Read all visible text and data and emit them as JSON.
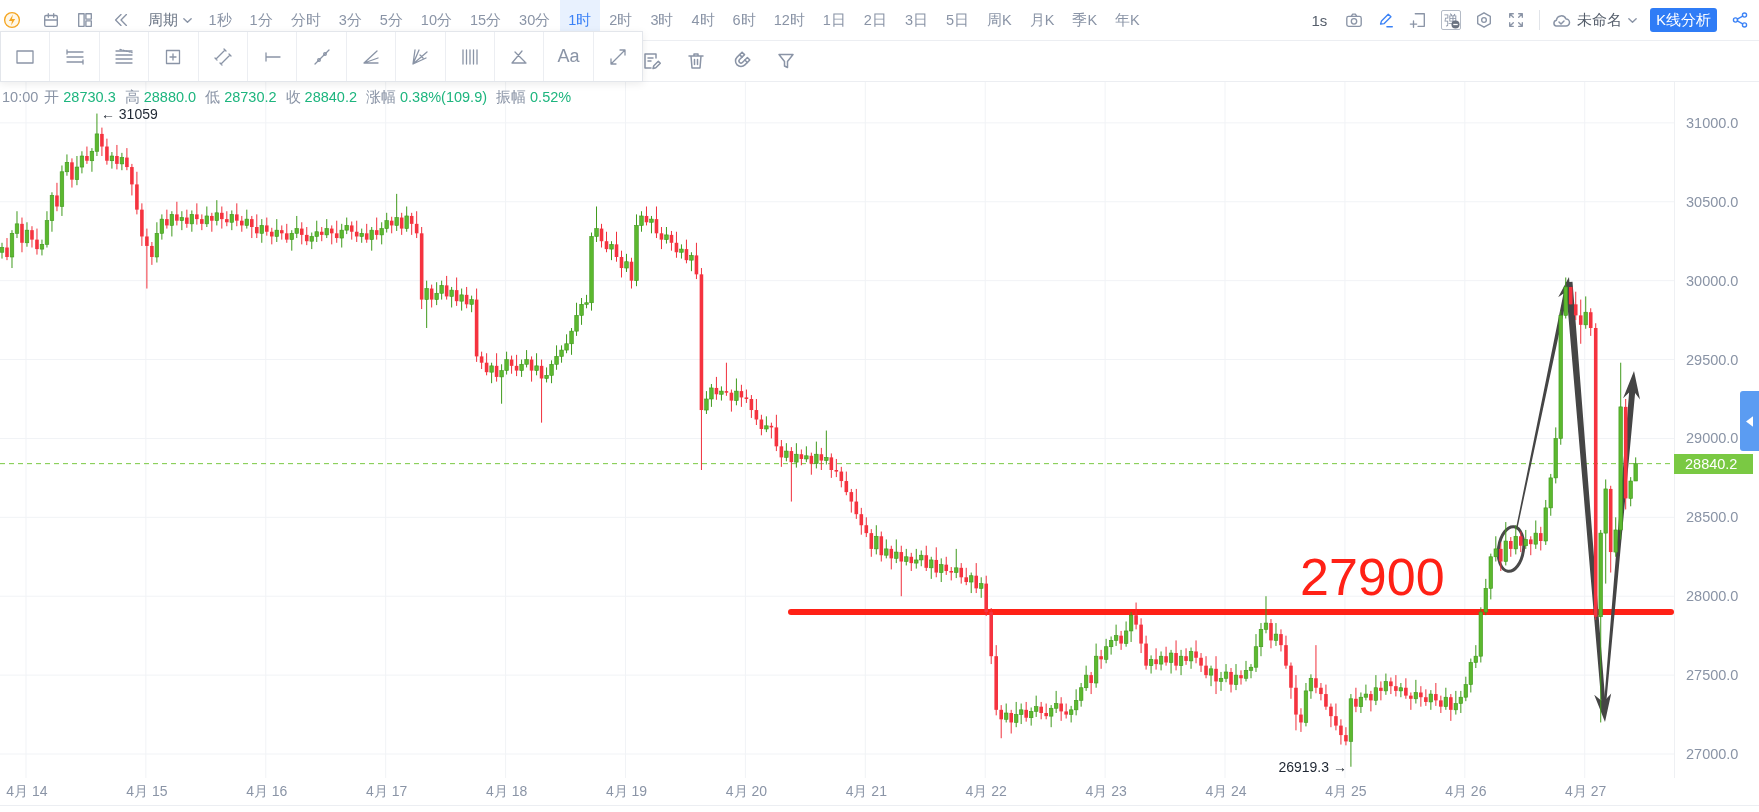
{
  "toolbar": {
    "period_label": "周期",
    "intervals": [
      {
        "label": "1秒",
        "selected": false
      },
      {
        "label": "1分",
        "selected": false
      },
      {
        "label": "分时",
        "selected": false
      },
      {
        "label": "3分",
        "selected": false
      },
      {
        "label": "5分",
        "selected": false
      },
      {
        "label": "10分",
        "selected": false
      },
      {
        "label": "15分",
        "selected": false
      },
      {
        "label": "30分",
        "selected": false
      },
      {
        "label": "1时",
        "selected": true
      },
      {
        "label": "2时",
        "selected": false
      },
      {
        "label": "3时",
        "selected": false
      },
      {
        "label": "4时",
        "selected": false
      },
      {
        "label": "6时",
        "selected": false
      },
      {
        "label": "12时",
        "selected": false
      },
      {
        "label": "1日",
        "selected": false
      },
      {
        "label": "2日",
        "selected": false
      },
      {
        "label": "3日",
        "selected": false
      },
      {
        "label": "5日",
        "selected": false
      },
      {
        "label": "周K",
        "selected": false
      },
      {
        "label": "月K",
        "selected": false
      },
      {
        "label": "季K",
        "selected": false
      },
      {
        "label": "年K",
        "selected": false
      }
    ],
    "refresh_rate": "1s",
    "drawing_mode": true,
    "barrage_icon_text": "弹",
    "layout_name": "未命名",
    "analysis_button": "K线分析"
  },
  "drawing_panel": {
    "text_tool": "Aa"
  },
  "ohlc": {
    "time": "10:00",
    "fields": [
      {
        "label": "开",
        "value": "28730.3"
      },
      {
        "label": "高",
        "value": "28880.0"
      },
      {
        "label": "低",
        "value": "28730.2"
      },
      {
        "label": "收",
        "value": "28840.2"
      },
      {
        "label": "涨幅",
        "value": "0.38%(109.9)"
      },
      {
        "label": "振幅",
        "value": "0.52%"
      }
    ]
  },
  "chart": {
    "chart_data": {
      "type": "candlestick",
      "categories": [
        null,
        null,
        null,
        null,
        null,
        "4月 14",
        null,
        null,
        null,
        null,
        null,
        null,
        null,
        null,
        null,
        null,
        null,
        null,
        null,
        null,
        null,
        null,
        null,
        null,
        null,
        null,
        null,
        null,
        null,
        "4月 15",
        null,
        null,
        null,
        null,
        null,
        null,
        null,
        null,
        null,
        null,
        null,
        null,
        null,
        null,
        null,
        null,
        null,
        null,
        null,
        null,
        null,
        null,
        null,
        "4月 16",
        null,
        null,
        null,
        null,
        null,
        null,
        null,
        null,
        null,
        null,
        null,
        null,
        null,
        null,
        null,
        null,
        null,
        null,
        null,
        null,
        null,
        null,
        null,
        "4月 17",
        null,
        null,
        null,
        null,
        null,
        null,
        null,
        null,
        null,
        null,
        null,
        null,
        null,
        null,
        null,
        null,
        null,
        null,
        null,
        null,
        null,
        null,
        null,
        "4月 18",
        null,
        null,
        null,
        null,
        null,
        null,
        null,
        null,
        null,
        null,
        null,
        null,
        null,
        null,
        null,
        null,
        null,
        null,
        null,
        null,
        null,
        null,
        null,
        "4月 19",
        null,
        null,
        null,
        null,
        null,
        null,
        null,
        null,
        null,
        null,
        null,
        null,
        null,
        null,
        null,
        null,
        null,
        null,
        null,
        null,
        null,
        null,
        null,
        "4月 20",
        null,
        null,
        null,
        null,
        null,
        null,
        null,
        null,
        null,
        null,
        null,
        null,
        null,
        null,
        null,
        null,
        null,
        null,
        null,
        null,
        null,
        null,
        null,
        "4月 21",
        null,
        null,
        null,
        null,
        null,
        null,
        null,
        null,
        null,
        null,
        null,
        null,
        null,
        null,
        null,
        null,
        null,
        null,
        null,
        null,
        null,
        null,
        null,
        "4月 22",
        null,
        null,
        null,
        null,
        null,
        null,
        null,
        null,
        null,
        null,
        null,
        null,
        null,
        null,
        null,
        null,
        null,
        null,
        null,
        null,
        null,
        null,
        null,
        "4月 23",
        null,
        null,
        null,
        null,
        null,
        null,
        null,
        null,
        null,
        null,
        null,
        null,
        null,
        null,
        null,
        null,
        null,
        null,
        null,
        null,
        null,
        null,
        null,
        "4月 24",
        null,
        null,
        null,
        null,
        null,
        null,
        null,
        null,
        null,
        null,
        null,
        null,
        null,
        null,
        null,
        null,
        null,
        null,
        null,
        null,
        null,
        null,
        null,
        "4月 25",
        null,
        null,
        null,
        null,
        null,
        null,
        null,
        null,
        null,
        null,
        null,
        null,
        null,
        null,
        null,
        null,
        null,
        null,
        null,
        null,
        null,
        null,
        null,
        "4月 26",
        null,
        null,
        null,
        null,
        null,
        null,
        null,
        null,
        null,
        null,
        null,
        null,
        null,
        null,
        null,
        null,
        null,
        null,
        null,
        null,
        null,
        null,
        null,
        "4月 27",
        null,
        null,
        null,
        null,
        null,
        null,
        null,
        null,
        null,
        null
      ],
      "ohlc": [
        [
          30180,
          30240,
          30140,
          30210
        ],
        [
          30210,
          30270,
          30130,
          30150
        ],
        [
          30150,
          30320,
          30080,
          30300
        ],
        [
          30300,
          30440,
          30270,
          30360
        ],
        [
          30360,
          30400,
          30180,
          30240
        ],
        [
          30240,
          30370,
          30215,
          30320
        ],
        [
          30320,
          30345,
          30210,
          30260
        ],
        [
          30260,
          30330,
          30165,
          30200
        ],
        [
          30200,
          30260,
          30160,
          30230
        ],
        [
          30230,
          30440,
          30210,
          30380
        ],
        [
          30380,
          30560,
          30310,
          30540
        ],
        [
          30540,
          30620,
          30440,
          30470
        ],
        [
          30470,
          30730,
          30410,
          30690
        ],
        [
          30690,
          30800,
          30665,
          30750
        ],
        [
          30750,
          30775,
          30590,
          30640
        ],
        [
          30640,
          30790,
          30605,
          30720
        ],
        [
          30720,
          30820,
          30680,
          30790
        ],
        [
          30790,
          30850,
          30740,
          30760
        ],
        [
          30760,
          30840,
          30690,
          30820
        ],
        [
          30820,
          31059,
          30790,
          30930
        ],
        [
          30930,
          30970,
          30790,
          30850
        ],
        [
          30850,
          30900,
          30735,
          30760
        ],
        [
          30760,
          30815,
          30710,
          30790
        ],
        [
          30790,
          30860,
          30705,
          30740
        ],
        [
          30740,
          30810,
          30700,
          30780
        ],
        [
          30780,
          30840,
          30700,
          30720
        ],
        [
          30720,
          30740,
          30540,
          30610
        ],
        [
          30610,
          30690,
          30420,
          30450
        ],
        [
          30450,
          30490,
          30220,
          30280
        ],
        [
          30280,
          30330,
          29950,
          30220
        ],
        [
          30220,
          30245,
          30100,
          30150
        ],
        [
          30150,
          30370,
          30115,
          30300
        ],
        [
          30300,
          30420,
          30260,
          30390
        ],
        [
          30390,
          30450,
          30330,
          30350
        ],
        [
          30350,
          30440,
          30280,
          30420
        ],
        [
          30420,
          30500,
          30350,
          30380
        ],
        [
          30380,
          30440,
          30320,
          30400
        ],
        [
          30400,
          30450,
          30335,
          30360
        ],
        [
          30360,
          30445,
          30310,
          30420
        ],
        [
          30420,
          30490,
          30355,
          30390
        ],
        [
          30390,
          30420,
          30320,
          30360
        ],
        [
          30360,
          30470,
          30340,
          30410
        ],
        [
          30410,
          30430,
          30310,
          30380
        ],
        [
          30380,
          30510,
          30350,
          30430
        ],
        [
          30430,
          30470,
          30330,
          30390
        ],
        [
          30390,
          30440,
          30345,
          30370
        ],
        [
          30370,
          30445,
          30320,
          30420
        ],
        [
          30420,
          30490,
          30345,
          30380
        ],
        [
          30380,
          30410,
          30310,
          30350
        ],
        [
          30350,
          30450,
          30330,
          30390
        ],
        [
          30390,
          30410,
          30270,
          30340
        ],
        [
          30340,
          30420,
          30270,
          30300
        ],
        [
          30300,
          30390,
          30240,
          30350
        ],
        [
          30350,
          30400,
          30285,
          30310
        ],
        [
          30310,
          30335,
          30230,
          30280
        ],
        [
          30280,
          30390,
          30245,
          30320
        ],
        [
          30320,
          30350,
          30260,
          30300
        ],
        [
          30300,
          30360,
          30240,
          30260
        ],
        [
          30260,
          30320,
          30190,
          30300
        ],
        [
          30300,
          30410,
          30270,
          30330
        ],
        [
          30330,
          30370,
          30230,
          30290
        ],
        [
          30290,
          30340,
          30225,
          30250
        ],
        [
          30250,
          30305,
          30200,
          30280
        ],
        [
          30280,
          30380,
          30245,
          30310
        ],
        [
          30310,
          30340,
          30250,
          30290
        ],
        [
          30290,
          30390,
          30270,
          30330
        ],
        [
          30330,
          30350,
          30230,
          30300
        ],
        [
          30300,
          30380,
          30240,
          30270
        ],
        [
          30270,
          30360,
          30210,
          30320
        ],
        [
          30320,
          30400,
          30295,
          30350
        ],
        [
          30350,
          30375,
          30260,
          30310
        ],
        [
          30310,
          30380,
          30245,
          30280
        ],
        [
          30280,
          30330,
          30240,
          30300
        ],
        [
          30300,
          30360,
          30240,
          30260
        ],
        [
          30260,
          30340,
          30190,
          30320
        ],
        [
          30320,
          30400,
          30260,
          30290
        ],
        [
          30290,
          30370,
          30230,
          30330
        ],
        [
          30330,
          30430,
          30305,
          30380
        ],
        [
          30380,
          30405,
          30300,
          30350
        ],
        [
          30350,
          30550,
          30315,
          30400
        ],
        [
          30400,
          30430,
          30290,
          30330
        ],
        [
          30330,
          30470,
          30310,
          30410
        ],
        [
          30410,
          30430,
          30290,
          30360
        ],
        [
          30360,
          30440,
          30270,
          30300
        ],
        [
          30300,
          30340,
          29820,
          29880
        ],
        [
          29880,
          30000,
          29700,
          29950
        ],
        [
          29950,
          29975,
          29830,
          29880
        ],
        [
          29880,
          29990,
          29845,
          29920
        ],
        [
          29920,
          30000,
          29880,
          29970
        ],
        [
          29970,
          30030,
          29880,
          29900
        ],
        [
          29900,
          29960,
          29830,
          29940
        ],
        [
          29940,
          30020,
          29840,
          29870
        ],
        [
          29870,
          29950,
          29810,
          29910
        ],
        [
          29910,
          29960,
          29825,
          29850
        ],
        [
          29850,
          29905,
          29800,
          29880
        ],
        [
          29880,
          29950,
          29485,
          29520
        ],
        [
          29520,
          29550,
          29440,
          29480
        ],
        [
          29480,
          29540,
          29400,
          29420
        ],
        [
          29420,
          29480,
          29350,
          29460
        ],
        [
          29460,
          29540,
          29360,
          29390
        ],
        [
          29390,
          29470,
          29220,
          29430
        ],
        [
          29430,
          29550,
          29405,
          29500
        ],
        [
          29500,
          29525,
          29410,
          29460
        ],
        [
          29460,
          29530,
          29395,
          29430
        ],
        [
          29430,
          29500,
          29390,
          29470
        ],
        [
          29470,
          29560,
          29450,
          29500
        ],
        [
          29500,
          29520,
          29360,
          29430
        ],
        [
          29430,
          29540,
          29400,
          29460
        ],
        [
          29460,
          29500,
          29100,
          29380
        ],
        [
          29380,
          29450,
          29355,
          29400
        ],
        [
          29400,
          29495,
          29350,
          29470
        ],
        [
          29470,
          29590,
          29435,
          29520
        ],
        [
          29520,
          29590,
          29480,
          29560
        ],
        [
          29560,
          29660,
          29540,
          29600
        ],
        [
          29600,
          29700,
          29530,
          29680
        ],
        [
          29680,
          29860,
          29650,
          29780
        ],
        [
          29780,
          29890,
          29720,
          29850
        ],
        [
          29850,
          29910,
          29825,
          29860
        ],
        [
          29860,
          30305,
          29810,
          30280
        ],
        [
          30280,
          30470,
          30245,
          30330
        ],
        [
          30330,
          30360,
          30210,
          30250
        ],
        [
          30250,
          30310,
          30180,
          30200
        ],
        [
          30200,
          30250,
          30130,
          30230
        ],
        [
          30230,
          30310,
          30120,
          30150
        ],
        [
          30150,
          30190,
          30020,
          30080
        ],
        [
          30080,
          30170,
          30055,
          30120
        ],
        [
          30120,
          30145,
          29950,
          30000
        ],
        [
          30000,
          30420,
          29965,
          30350
        ],
        [
          30350,
          30440,
          30310,
          30410
        ],
        [
          30410,
          30470,
          30350,
          30370
        ],
        [
          30370,
          30410,
          30300,
          30390
        ],
        [
          30390,
          30470,
          30270,
          30300
        ],
        [
          30300,
          30340,
          30200,
          30260
        ],
        [
          30260,
          30340,
          30235,
          30290
        ],
        [
          30290,
          30315,
          30190,
          30240
        ],
        [
          30240,
          30310,
          30145,
          30180
        ],
        [
          30180,
          30230,
          30140,
          30200
        ],
        [
          30200,
          30260,
          30110,
          30130
        ],
        [
          30130,
          30180,
          30060,
          30160
        ],
        [
          30160,
          30240,
          30010,
          30040
        ],
        [
          30040,
          30080,
          28800,
          29180
        ],
        [
          29180,
          29300,
          29155,
          29250
        ],
        [
          29250,
          29345,
          29200,
          29320
        ],
        [
          29320,
          29390,
          29245,
          29280
        ],
        [
          29280,
          29330,
          29240,
          29300
        ],
        [
          29300,
          29480,
          29270,
          29290
        ],
        [
          29290,
          29310,
          29170,
          29240
        ],
        [
          29240,
          29380,
          29210,
          29300
        ],
        [
          29300,
          29340,
          29200,
          29260
        ],
        [
          29260,
          29310,
          29225,
          29250
        ],
        [
          29250,
          29275,
          29130,
          29180
        ],
        [
          29180,
          29250,
          29085,
          29120
        ],
        [
          29120,
          29150,
          29020,
          29060
        ],
        [
          29060,
          29140,
          29040,
          29080
        ],
        [
          29080,
          29100,
          29000,
          29070
        ],
        [
          29070,
          29150,
          28920,
          28950
        ],
        [
          28950,
          28990,
          28820,
          28880
        ],
        [
          28880,
          28970,
          28855,
          28920
        ],
        [
          28920,
          28945,
          28600,
          28850
        ],
        [
          28850,
          28970,
          28815,
          28900
        ],
        [
          28900,
          28930,
          28830,
          28870
        ],
        [
          28870,
          28950,
          28850,
          28890
        ],
        [
          28890,
          28910,
          28770,
          28840
        ],
        [
          28840,
          28980,
          28810,
          28900
        ],
        [
          28900,
          28940,
          28800,
          28860
        ],
        [
          28860,
          29050,
          28835,
          28880
        ],
        [
          28880,
          28905,
          28750,
          28800
        ],
        [
          28800,
          28870,
          28755,
          28790
        ],
        [
          28790,
          28820,
          28690,
          28730
        ],
        [
          28730,
          28790,
          28640,
          28660
        ],
        [
          28660,
          28680,
          28530,
          28600
        ],
        [
          28600,
          28680,
          28490,
          28520
        ],
        [
          28520,
          28560,
          28390,
          28450
        ],
        [
          28450,
          28500,
          28375,
          28400
        ],
        [
          28400,
          28425,
          28250,
          28300
        ],
        [
          28300,
          28450,
          28265,
          28380
        ],
        [
          28380,
          28410,
          28220,
          28260
        ],
        [
          28260,
          28360,
          28240,
          28300
        ],
        [
          28300,
          28320,
          28170,
          28240
        ],
        [
          28240,
          28360,
          28210,
          28280
        ],
        [
          28280,
          28320,
          28000,
          28220
        ],
        [
          28220,
          28300,
          28195,
          28250
        ],
        [
          28250,
          28275,
          28160,
          28210
        ],
        [
          28210,
          28300,
          28175,
          28230
        ],
        [
          28230,
          28290,
          28190,
          28260
        ],
        [
          28260,
          28320,
          28160,
          28180
        ],
        [
          28180,
          28250,
          28110,
          28230
        ],
        [
          28230,
          28310,
          28120,
          28150
        ],
        [
          28150,
          28240,
          28090,
          28200
        ],
        [
          28200,
          28250,
          28135,
          28160
        ],
        [
          28160,
          28185,
          28100,
          28150
        ],
        [
          28150,
          28300,
          28115,
          28180
        ],
        [
          28180,
          28210,
          28080,
          28120
        ],
        [
          28120,
          28180,
          28070,
          28090
        ],
        [
          28090,
          28150,
          28020,
          28130
        ],
        [
          28130,
          28210,
          28020,
          28050
        ],
        [
          28050,
          28120,
          27990,
          28080
        ],
        [
          28080,
          28130,
          27875,
          27900
        ],
        [
          27900,
          27925,
          27570,
          27620
        ],
        [
          27620,
          27690,
          27245,
          27280
        ],
        [
          27280,
          27310,
          27100,
          27220
        ],
        [
          27220,
          27320,
          27200,
          27260
        ],
        [
          27260,
          27280,
          27130,
          27200
        ],
        [
          27200,
          27330,
          27170,
          27250
        ],
        [
          27250,
          27320,
          27190,
          27280
        ],
        [
          27280,
          27330,
          27205,
          27230
        ],
        [
          27230,
          27295,
          27180,
          27270
        ],
        [
          27270,
          27370,
          27235,
          27300
        ],
        [
          27300,
          27330,
          27220,
          27260
        ],
        [
          27260,
          27320,
          27220,
          27240
        ],
        [
          27240,
          27310,
          27170,
          27290
        ],
        [
          27290,
          27400,
          27260,
          27320
        ],
        [
          27320,
          27360,
          27210,
          27270
        ],
        [
          27270,
          27320,
          27225,
          27250
        ],
        [
          27250,
          27305,
          27200,
          27280
        ],
        [
          27280,
          27410,
          27245,
          27340
        ],
        [
          27340,
          27450,
          27300,
          27420
        ],
        [
          27420,
          27560,
          27400,
          27500
        ],
        [
          27500,
          27520,
          27380,
          27450
        ],
        [
          27450,
          27700,
          27420,
          27620
        ],
        [
          27620,
          27660,
          27540,
          27600
        ],
        [
          27600,
          27730,
          27575,
          27680
        ],
        [
          27680,
          27745,
          27630,
          27720
        ],
        [
          27720,
          27820,
          27685,
          27750
        ],
        [
          27750,
          27780,
          27660,
          27700
        ],
        [
          27700,
          27840,
          27680,
          27780
        ],
        [
          27780,
          27900,
          27710,
          27880
        ],
        [
          27880,
          27960,
          27790,
          27820
        ],
        [
          27820,
          27860,
          27640,
          27700
        ],
        [
          27700,
          27750,
          27535,
          27560
        ],
        [
          27560,
          27625,
          27510,
          27600
        ],
        [
          27600,
          27670,
          27535,
          27570
        ],
        [
          27570,
          27650,
          27530,
          27620
        ],
        [
          27620,
          27680,
          27560,
          27580
        ],
        [
          27580,
          27660,
          27510,
          27640
        ],
        [
          27640,
          27720,
          27530,
          27560
        ],
        [
          27560,
          27660,
          27500,
          27620
        ],
        [
          27620,
          27670,
          27565,
          27590
        ],
        [
          27590,
          27675,
          27540,
          27650
        ],
        [
          27650,
          27720,
          27575,
          27610
        ],
        [
          27610,
          27640,
          27520,
          27560
        ],
        [
          27560,
          27620,
          27480,
          27500
        ],
        [
          27500,
          27560,
          27430,
          27540
        ],
        [
          27540,
          27620,
          27380,
          27460
        ],
        [
          27460,
          27520,
          27400,
          27480
        ],
        [
          27480,
          27570,
          27455,
          27520
        ],
        [
          27520,
          27545,
          27390,
          27440
        ],
        [
          27440,
          27570,
          27405,
          27500
        ],
        [
          27500,
          27530,
          27440,
          27480
        ],
        [
          27480,
          27590,
          27460,
          27530
        ],
        [
          27530,
          27570,
          27480,
          27550
        ],
        [
          27550,
          27760,
          27520,
          27680
        ],
        [
          27680,
          27830,
          27620,
          27790
        ],
        [
          27790,
          28000,
          27765,
          27830
        ],
        [
          27830,
          27855,
          27670,
          27720
        ],
        [
          27720,
          27830,
          27685,
          27760
        ],
        [
          27760,
          27790,
          27650,
          27690
        ],
        [
          27690,
          27750,
          27540,
          27560
        ],
        [
          27560,
          27580,
          27350,
          27420
        ],
        [
          27420,
          27500,
          27150,
          27250
        ],
        [
          27250,
          27290,
          27140,
          27200
        ],
        [
          27200,
          27450,
          27175,
          27400
        ],
        [
          27400,
          27505,
          27350,
          27480
        ],
        [
          27480,
          27690,
          27385,
          27420
        ],
        [
          27420,
          27450,
          27340,
          27380
        ],
        [
          27380,
          27440,
          27280,
          27300
        ],
        [
          27300,
          27320,
          27170,
          27240
        ],
        [
          27240,
          27320,
          27150,
          27180
        ],
        [
          27180,
          27220,
          27060,
          27120
        ],
        [
          27120,
          27170,
          27055,
          27080
        ],
        [
          27080,
          27380,
          26919.3,
          27350
        ],
        [
          27350,
          27420,
          27265,
          27300
        ],
        [
          27300,
          27390,
          27260,
          27360
        ],
        [
          27360,
          27440,
          27340,
          27380
        ],
        [
          27380,
          27400,
          27270,
          27340
        ],
        [
          27340,
          27500,
          27310,
          27420
        ],
        [
          27420,
          27460,
          27340,
          27400
        ],
        [
          27400,
          27510,
          27375,
          27460
        ],
        [
          27460,
          27485,
          27380,
          27430
        ],
        [
          27430,
          27500,
          27365,
          27400
        ],
        [
          27400,
          27450,
          27360,
          27420
        ],
        [
          27420,
          27480,
          27350,
          27370
        ],
        [
          27370,
          27390,
          27280,
          27350
        ],
        [
          27350,
          27470,
          27320,
          27390
        ],
        [
          27390,
          27430,
          27300,
          27360
        ],
        [
          27360,
          27410,
          27305,
          27330
        ],
        [
          27330,
          27405,
          27280,
          27380
        ],
        [
          27380,
          27450,
          27305,
          27340
        ],
        [
          27340,
          27370,
          27260,
          27300
        ],
        [
          27300,
          27420,
          27280,
          27360
        ],
        [
          27360,
          27380,
          27210,
          27280
        ],
        [
          27280,
          27400,
          27250,
          27320
        ],
        [
          27320,
          27400,
          27260,
          27360
        ],
        [
          27360,
          27490,
          27335,
          27440
        ],
        [
          27440,
          27605,
          27390,
          27580
        ],
        [
          27580,
          27690,
          27545,
          27620
        ],
        [
          27620,
          27930,
          27580,
          27900
        ],
        [
          27900,
          28110,
          27880,
          28050
        ],
        [
          28050,
          28270,
          27980,
          28250
        ],
        [
          28250,
          28380,
          28220,
          28300
        ],
        [
          28300,
          28340,
          28160,
          28220
        ],
        [
          28220,
          28470,
          28195,
          28350
        ],
        [
          28350,
          28375,
          28250,
          28300
        ],
        [
          28300,
          28450,
          28265,
          28380
        ],
        [
          28380,
          28410,
          28280,
          28320
        ],
        [
          28320,
          28420,
          28300,
          28360
        ],
        [
          28360,
          28380,
          28260,
          28330
        ],
        [
          28330,
          28480,
          28300,
          28400
        ],
        [
          28400,
          28440,
          28290,
          28350
        ],
        [
          28350,
          28610,
          28325,
          28560
        ],
        [
          28560,
          28775,
          28510,
          28750
        ],
        [
          28750,
          29070,
          28715,
          29000
        ],
        [
          29000,
          29810,
          28960,
          29780
        ],
        [
          29780,
          30020,
          29760,
          29960
        ],
        [
          29960,
          29960,
          29850,
          29850
        ],
        [
          29850,
          29930,
          29750,
          29780
        ],
        [
          29780,
          29880,
          29600,
          29720
        ],
        [
          29720,
          29900,
          29695,
          29800
        ],
        [
          29800,
          29825,
          29650,
          29700
        ],
        [
          29700,
          29730,
          27850,
          27870
        ],
        [
          27870,
          28420,
          27200,
          28400
        ],
        [
          28400,
          28740,
          28080,
          28680
        ],
        [
          28680,
          28700,
          28150,
          28280
        ],
        [
          28280,
          28500,
          28250,
          28420
        ],
        [
          28420,
          29480,
          28360,
          29200
        ],
        [
          29200,
          29250,
          28550,
          28620
        ],
        [
          28620,
          28755,
          28570,
          28730.3
        ],
        [
          28730.3,
          28880,
          28730.2,
          28840.2
        ]
      ],
      "ylim": [
        26848,
        31259
      ],
      "grid": true,
      "yticks": [
        {
          "value": 31000,
          "label": "31000.0"
        },
        {
          "value": 30500,
          "label": "30500.0"
        },
        {
          "value": 30000,
          "label": "30000.0"
        },
        {
          "value": 29500,
          "label": "29500.0"
        },
        {
          "value": 29000,
          "label": "29000.0"
        },
        {
          "value": 28500,
          "label": "28500.0"
        },
        {
          "value": 28000,
          "label": "28000.0"
        },
        {
          "value": 27500,
          "label": "27500.0"
        },
        {
          "value": 27000,
          "label": "27000.0"
        }
      ],
      "annotations": [
        "← 31059",
        "26919.3 →"
      ],
      "ref_lines": [
        {
          "axis": "y",
          "value": 28840.2,
          "label": "28840.2",
          "color": "#7ac943"
        },
        {
          "axis": "y",
          "value": 27900,
          "label": "27900",
          "color": "#ff2116"
        }
      ]
    }
  }
}
